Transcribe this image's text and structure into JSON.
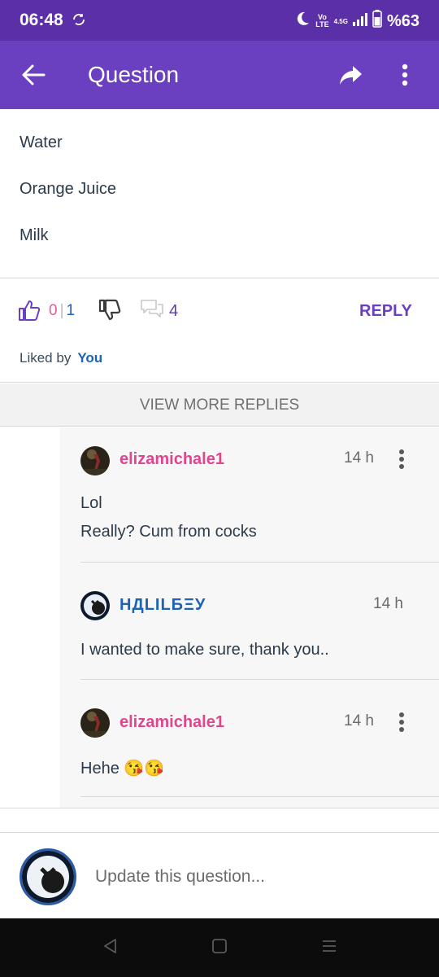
{
  "status_bar": {
    "time": "06:48",
    "network_top": "Vo",
    "network_bottom": "LTE",
    "network_type": "4.5G",
    "battery": "%63",
    "icons": [
      "sync-icon",
      "moon-icon",
      "signal-icon",
      "battery-icon"
    ]
  },
  "app_bar": {
    "title": "Question",
    "icons": [
      "back-arrow-icon",
      "share-icon",
      "more-vertical-icon"
    ],
    "background": "#6a3fc0"
  },
  "options": [
    "Water",
    "Orange Juice",
    "Milk"
  ],
  "actions": {
    "likes": "0",
    "likes_separator": "|",
    "likes_total": "1",
    "comments": "4",
    "reply_label": "REPLY",
    "liked_by_label": "Liked by",
    "liked_by_user": "You"
  },
  "view_more_replies": "VIEW MORE REPLIES",
  "replies": [
    {
      "username": "elizamichale1",
      "time": "14 h",
      "lines": [
        "Lol",
        "Really? Cum from cocks"
      ]
    },
    {
      "username": "НДLILБΞУ",
      "time": "14 h",
      "lines": [
        "I wanted to make sure, thank you.."
      ]
    },
    {
      "username": "elizamichale1",
      "time": "14 h",
      "lines": [
        "Hehe 😘😘"
      ]
    }
  ],
  "composer": {
    "placeholder": "Update this question..."
  },
  "colors": {
    "accent": "#6a3fc0",
    "pink_user": "#e0468e",
    "blue_user": "#1f62b4"
  }
}
